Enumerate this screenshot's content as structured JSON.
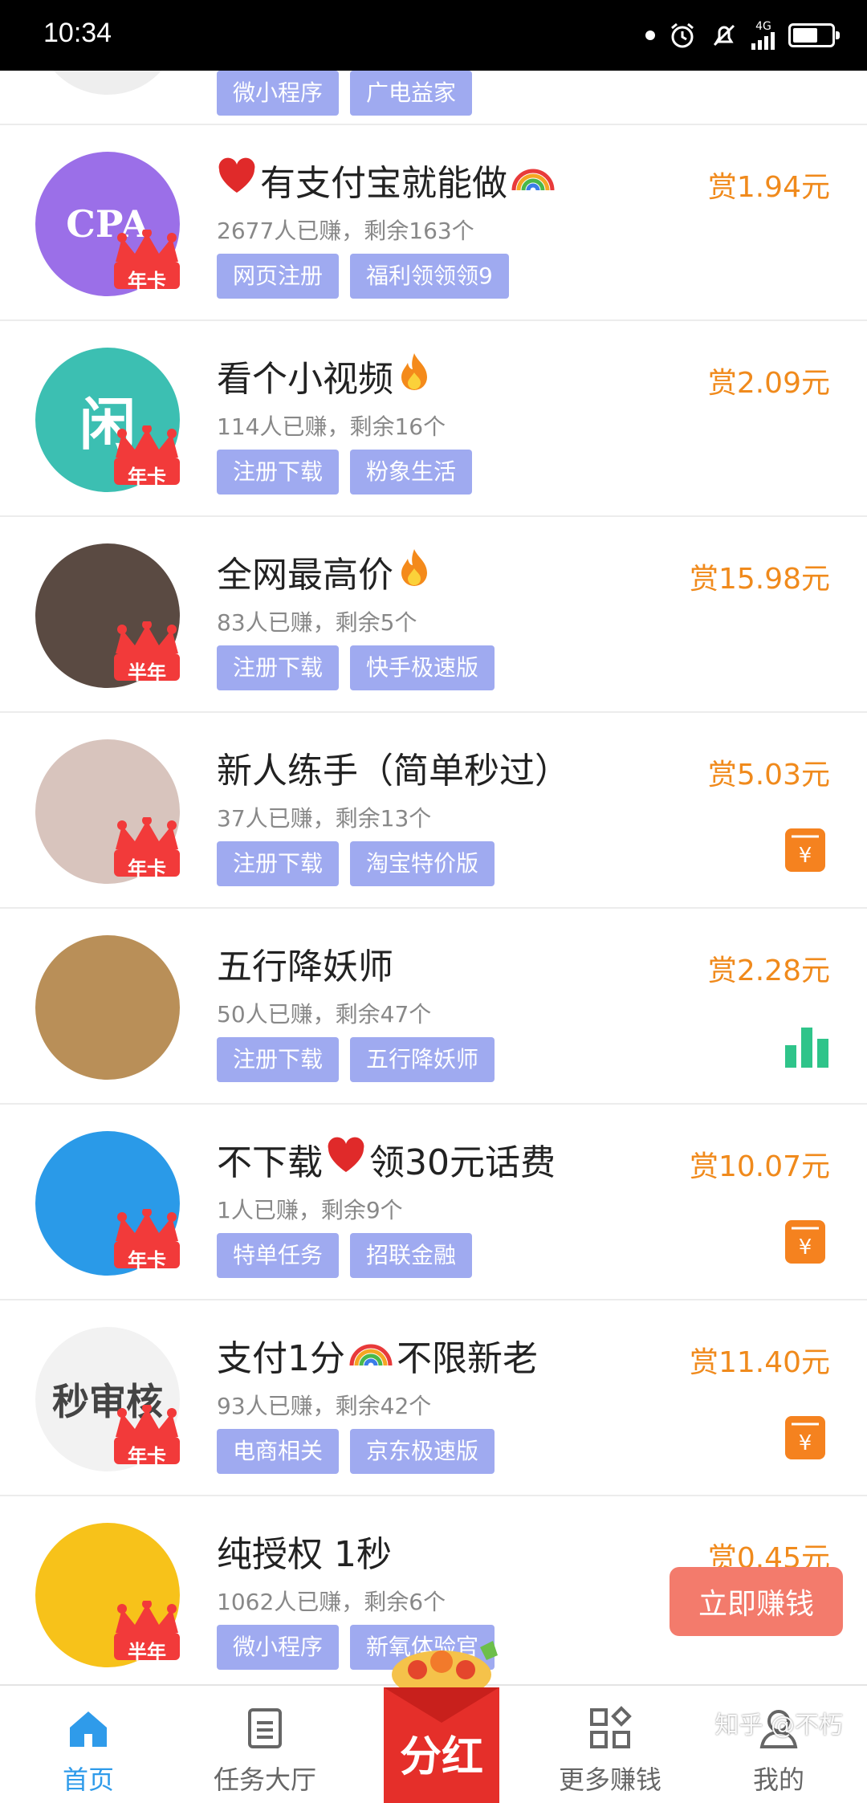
{
  "status_bar": {
    "time": "10:34",
    "network": "4G",
    "battery_level": 0.7
  },
  "first_row": {
    "tags": [
      "微小程序",
      "广电益家"
    ]
  },
  "tasks": [
    {
      "title": "有支付宝就能做",
      "title_prefix_icon": "heart-icon",
      "title_suffix_icon": "rainbow-icon",
      "stats": "2677人已赚，剩余163个",
      "tags": [
        "网页注册",
        "福利领领领9"
      ],
      "reward": "赏1.94元",
      "badge": "年卡",
      "avatar_text": "CPA",
      "avatar_color": "#9b6fe8",
      "side_icon": ""
    },
    {
      "title": "看个小视频",
      "title_suffix_icon": "fire-icon",
      "stats": "114人已赚，剩余16个",
      "tags": [
        "注册下载",
        "粉象生活"
      ],
      "reward": "赏2.09元",
      "badge": "年卡",
      "avatar_text": "闲",
      "avatar_color": "#3cbfb2",
      "side_icon": ""
    },
    {
      "title": "全网最高价",
      "title_suffix_icon": "fire-icon",
      "stats": "83人已赚，剩余5个",
      "tags": [
        "注册下载",
        "快手极速版"
      ],
      "reward": "赏15.98元",
      "badge": "半年",
      "avatar_text": "",
      "avatar_color": "#5a4a42",
      "side_icon": ""
    },
    {
      "title": "新人练手（简单秒过）",
      "stats": "37人已赚，剩余13个",
      "tags": [
        "注册下载",
        "淘宝特价版"
      ],
      "reward": "赏5.03元",
      "badge": "年卡",
      "avatar_text": "",
      "avatar_color": "#d8c4bd",
      "side_icon": "wallet-yuan-icon"
    },
    {
      "title": "五行降妖师",
      "stats": "50人已赚，剩余47个",
      "tags": [
        "注册下载",
        "五行降妖师"
      ],
      "reward": "赏2.28元",
      "badge": "",
      "avatar_text": "",
      "avatar_color": "#b98f58",
      "side_icon": "bar-chart-icon"
    },
    {
      "title": "不下载",
      "title_mid_icon": "heart-icon",
      "title_tail": "领30元话费",
      "stats": "1人已赚，剩余9个",
      "tags": [
        "特单任务",
        "招联金融"
      ],
      "reward": "赏10.07元",
      "badge": "年卡",
      "avatar_text": "",
      "avatar_color": "#2a9ae8",
      "side_icon": "wallet-yuan-icon"
    },
    {
      "title": "支付1分",
      "title_mid_icon": "rainbow-icon",
      "title_tail": "不限新老",
      "stats": "93人已赚，剩余42个",
      "tags": [
        "电商相关",
        "京东极速版"
      ],
      "reward": "赏11.40元",
      "badge": "年卡",
      "avatar_text": "秒审核",
      "avatar_color": "#f2f2f2",
      "side_icon": "wallet-yuan-icon"
    },
    {
      "title": "纯授权 1秒",
      "stats": "1062人已赚，剩余6个",
      "tags": [
        "微小程序",
        "新氧体验官"
      ],
      "reward": "赏0.45元",
      "badge": "半年",
      "avatar_text": "",
      "avatar_color": "#f7c21a",
      "side_icon": ""
    }
  ],
  "floating_button": {
    "label": "立即赚钱"
  },
  "center_button": {
    "label": "分红"
  },
  "tabbar": {
    "items": [
      {
        "label": "首页",
        "icon": "home-icon",
        "active": true
      },
      {
        "label": "任务大厅",
        "icon": "task-list-icon",
        "active": false
      },
      {
        "label": "更多赚钱",
        "icon": "grid-apps-icon",
        "active": false
      },
      {
        "label": "我的",
        "icon": "user-icon",
        "active": false
      }
    ]
  },
  "watermark": "知乎 @不朽",
  "colors": {
    "reward": "#f08a1c",
    "tag_bg": "#9faaf0",
    "active_tab": "#2f9bea",
    "earn_button": "#f37b6c"
  }
}
